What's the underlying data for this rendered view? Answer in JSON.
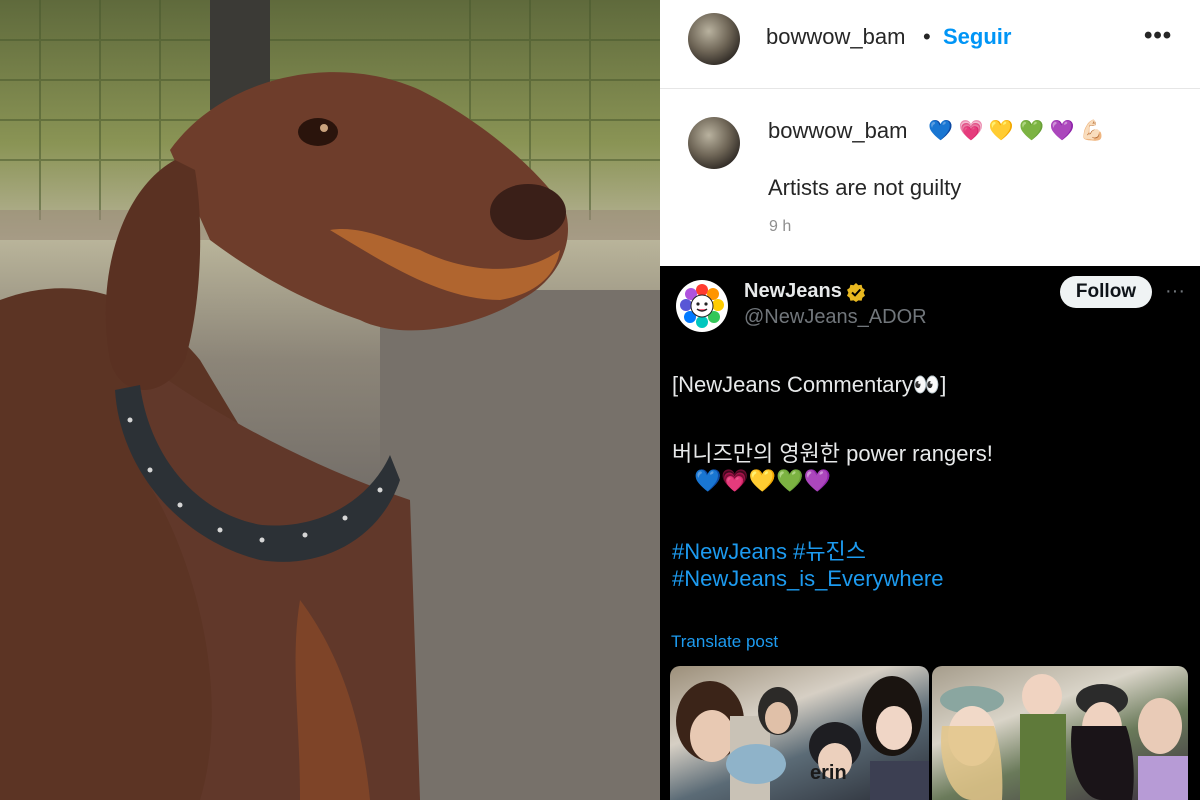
{
  "instagram": {
    "username": "bowwow_bam",
    "separator": "•",
    "follow_label": "Seguir",
    "more_label": "•••",
    "comment": {
      "username": "bowwow_bam",
      "emojis": "💙 💗 💛 💚 💜 💪🏻",
      "text": "Artists are not guilty",
      "time": "9 h"
    }
  },
  "tweet": {
    "name": "NewJeans",
    "handle": "@NewJeans_ADOR",
    "follow_label": "Follow",
    "more_label": "···",
    "line1": "[NewJeans Commentary👀]",
    "line2": "버니즈만의 영원한 power rangers!",
    "line3": "💙💗💛💚💜",
    "hashtags": {
      "tag1": "#NewJeans",
      "tag2": "#뉴진스",
      "tag3": "#NewJeans_is_Everywhere"
    },
    "translate_label": "Translate post",
    "media_caption": "erin"
  },
  "colors": {
    "instagram_link": "#0095f6",
    "twitter_bg": "#000000",
    "twitter_link": "#1d9bf0",
    "verified_gold": "#e8b820"
  },
  "icons": [
    "verified-badge-icon",
    "more-dots-icon",
    "flower-logo-icon"
  ]
}
